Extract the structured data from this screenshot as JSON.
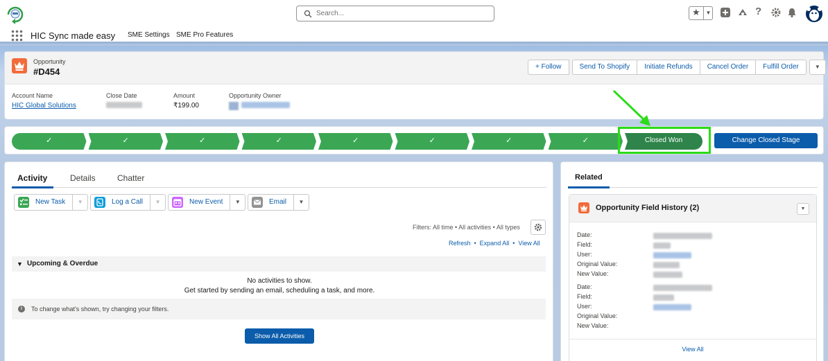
{
  "global_header": {
    "search_placeholder": "Search..."
  },
  "app_nav": {
    "app_name": "HIC Sync made easy",
    "items": [
      "SME Settings",
      "SME Pro Features"
    ]
  },
  "record": {
    "object_label": "Opportunity",
    "name": "#D454",
    "actions": [
      "Follow",
      "Send To Shopify",
      "Initiate Refunds",
      "Cancel Order",
      "Fulfill Order"
    ],
    "follow_prefix": "+",
    "fields": {
      "account_name_label": "Account Name",
      "account_name_value": "HIC Global Solutions",
      "close_date_label": "Close Date",
      "amount_label": "Amount",
      "amount_value": "₹199.00",
      "owner_label": "Opportunity Owner"
    }
  },
  "path": {
    "completed_steps": 8,
    "current_stage": "Closed Won",
    "stage_button": "Change Closed Stage"
  },
  "activity": {
    "tabs": [
      "Activity",
      "Details",
      "Chatter"
    ],
    "active_tab": "Activity",
    "publishers": [
      {
        "label": "New Task",
        "icon": "task-icon",
        "color": "#3ba755"
      },
      {
        "label": "Log a Call",
        "icon": "call-icon",
        "color": "#0d9dda"
      },
      {
        "label": "New Event",
        "icon": "event-icon",
        "color": "#cb65ff"
      },
      {
        "label": "Email",
        "icon": "email-icon",
        "color": "#939393"
      }
    ],
    "filters": "Filters: All time • All activities • All types",
    "links": [
      "Refresh",
      "Expand All",
      "View All"
    ],
    "section_title": "Upcoming & Overdue",
    "empty_line1": "No activities to show.",
    "empty_line2": "Get started by sending an email, scheduling a task, and more.",
    "info": "To change what's shown, try changing your filters.",
    "show_all": "Show All Activities"
  },
  "related": {
    "tab": "Related",
    "list_title": "Opportunity Field History (2)",
    "history_labels_1": [
      "Date:",
      "Field:",
      "User:",
      "Original Value:",
      "New Value:"
    ],
    "history_labels_2": [
      "Date:",
      "Field:",
      "User:",
      "Original Value:",
      "New Value:"
    ],
    "view_all": "View All"
  },
  "colors": {
    "brand_blue": "#0b5cab",
    "path_green": "#3ba755",
    "path_current": "#2e844a",
    "highlight": "#2bdc17",
    "object_orange": "#f26b3a"
  }
}
